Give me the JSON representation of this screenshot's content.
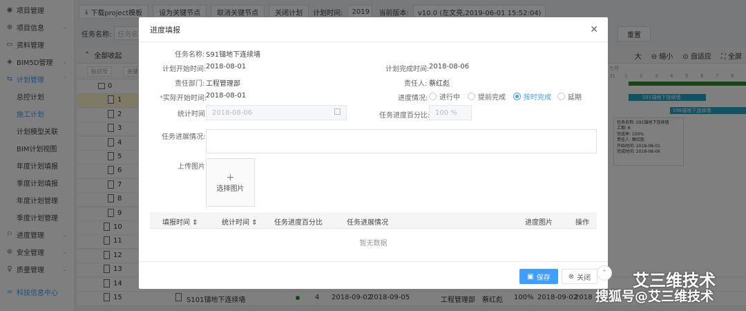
{
  "sidebar": {
    "items": [
      {
        "icon": "user-icon",
        "glyph": "◉",
        "label": "项目管理",
        "chev": ""
      },
      {
        "icon": "globe-icon",
        "glyph": "⊕",
        "label": "项目信息",
        "chev": "⌄"
      },
      {
        "icon": "folder-icon",
        "glyph": "▭",
        "label": "资料管理",
        "chev": ""
      },
      {
        "icon": "cube-icon",
        "glyph": "◈",
        "label": "BIM5D管理",
        "chev": "⌄"
      },
      {
        "icon": "plan-icon",
        "glyph": "⇆",
        "label": "计划管理",
        "chev": "⌃"
      }
    ],
    "sub_items": [
      "总控计划",
      "施工计划",
      "计划模型关联",
      "BIM计划视图",
      "年度计划填报",
      "季度计划填报",
      "年度计划管理",
      "季度计划管理"
    ],
    "bottom_items": [
      {
        "icon": "flag-icon",
        "glyph": "⚐",
        "label": "进度管理",
        "chev": "⌄"
      },
      {
        "icon": "safety-icon",
        "glyph": "⊛",
        "label": "安全管理",
        "chev": "⌄"
      },
      {
        "icon": "quality-icon",
        "glyph": "♀",
        "label": "质量管理",
        "chev": "⌄"
      },
      {
        "icon": "link-icon",
        "glyph": "∞",
        "label": "科技信息中心",
        "chev": ""
      }
    ]
  },
  "toolbar": {
    "download": "下载project模板",
    "set_key": "设为关键节点",
    "cancel_key": "取消关键节点",
    "close_plan": "关闭计划",
    "plan_time_label": "计划时间:",
    "plan_time_value": "2019",
    "version_label": "当前版本:",
    "version_value": "v10.0 (左文亮,2019-06-01 15:52:04)"
  },
  "filter": {
    "task_name_label": "任务名称:",
    "placeholder": "任务名",
    "reset": "重置"
  },
  "grid": {
    "collapse_all": "全部收起",
    "col_seq": "标识号",
    "col_key": "关键",
    "zoom_out_fragment": "大",
    "shrink": "缩小",
    "adaptive": "自适应",
    "fullscreen": "全屏",
    "month": "七月",
    "days": [
      "31",
      "1",
      "2",
      "3",
      "4",
      "5",
      "6",
      "7",
      "8"
    ],
    "row_numbers": [
      "0",
      "1",
      "2",
      "3",
      "4",
      "5",
      "6",
      "7",
      "8",
      "9",
      "10",
      "11",
      "12",
      "13",
      "14",
      "15"
    ],
    "row15": {
      "name": "S101锚地下连续墙",
      "dur": "4",
      "start": "2018-09-02",
      "end": "2018-09-05",
      "dept": "工程管理部",
      "person": "蔡红彪",
      "pct": "100%",
      "date": "2018-09-02",
      "extra": "2018"
    },
    "bar1_label": "S91锚地下连续墙",
    "bar2_label": "S96锚地下连续墙",
    "tooltip": [
      "任务名称: S91锚地下连续墙",
      "工期: 6",
      "完成率: 100%",
      "责任人: 蔡红彪",
      "开始时间: 2018-08-01",
      "完成时间: 2018-08-06"
    ]
  },
  "modal": {
    "title": "进度填报",
    "task_name_label": "任务名称:",
    "task_name": "S91锚地下连续墙",
    "plan_start_label": "计划开始时间:",
    "plan_start": "2018-08-01",
    "plan_end_label": "计划完成时间:",
    "plan_end": "2018-08-06",
    "dept_label": "责任部门:",
    "dept": "工程管理部",
    "person_label": "责任人:",
    "person": "蔡红彪",
    "actual_start_label": "实际开始时间:",
    "actual_start": "2018-08-01",
    "status_label": "进度情况:",
    "status_options": [
      "进行中",
      "提前完成",
      "按时完成",
      "延期"
    ],
    "status_selected": "按时完成",
    "stat_time_label": "统计时间:",
    "stat_time": "2018-08-06",
    "pct_label": "任务进度百分比:",
    "pct_placeholder": "100 %",
    "progress_label": "任务进展情况:",
    "upload_label": "上传图片:",
    "upload_plus": "+",
    "upload_text": "选择图片",
    "table_headers": [
      "填报时间",
      "统计时间",
      "任务进度百分比",
      "任务进展情况",
      "进度图片",
      "操作"
    ],
    "sort_glyph": "⇕",
    "empty": "暂无数据",
    "save": "保存",
    "close": "关闭"
  },
  "watermark": {
    "line1": "艾三维技术",
    "line2": "搜狐号@艾三维技术"
  }
}
